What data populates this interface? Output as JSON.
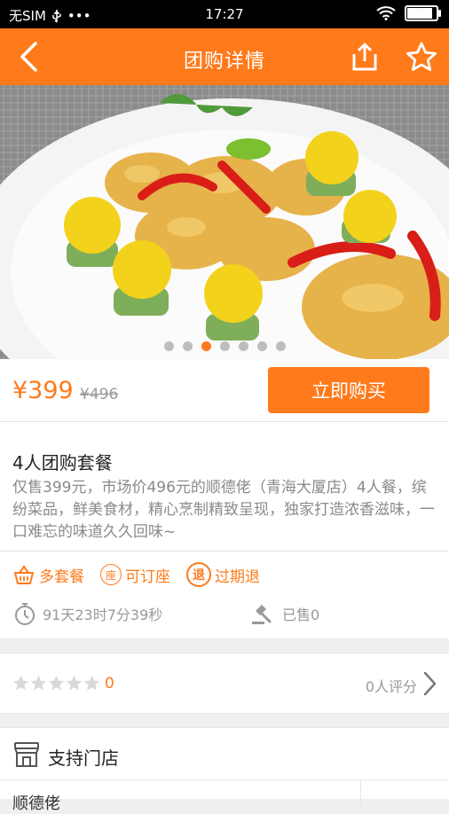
{
  "status": {
    "carrier": "无SIM",
    "dots": "•••",
    "time": "17:27",
    "battery_level": 0.92
  },
  "navbar": {
    "title": "团购详情",
    "back_icon": "back-chevron-icon",
    "share_icon": "share-icon",
    "favorite_icon": "star-outline-icon"
  },
  "carousel": {
    "count": 7,
    "active_index": 2
  },
  "price": {
    "current": "¥399",
    "original": "¥496",
    "buy_label": "立即购买"
  },
  "deal": {
    "title": "4人团购套餐",
    "description": "仅售399元，市场价496元的顺德佬（青海大厦店）4人餐，缤纷菜品，鲜美食材，精心烹制精致呈现，独家打造浓香滋味，一口难忘的味道久久回味~",
    "tags": [
      {
        "icon": "basket-icon",
        "label": "多套餐"
      },
      {
        "icon": "seat-badge-icon",
        "badge": "座",
        "label": "可订座"
      },
      {
        "icon": "refund-badge-icon",
        "badge": "退",
        "label": "过期退"
      }
    ],
    "countdown": "91天23时7分39秒",
    "sold": "已售0"
  },
  "rating": {
    "stars_filled": 0,
    "stars_total": 5,
    "score": "0",
    "reviews": "0人评分"
  },
  "stores": {
    "title": "支持门店",
    "first_store": "顺德佬"
  },
  "colors": {
    "accent": "#ff7a1a"
  }
}
